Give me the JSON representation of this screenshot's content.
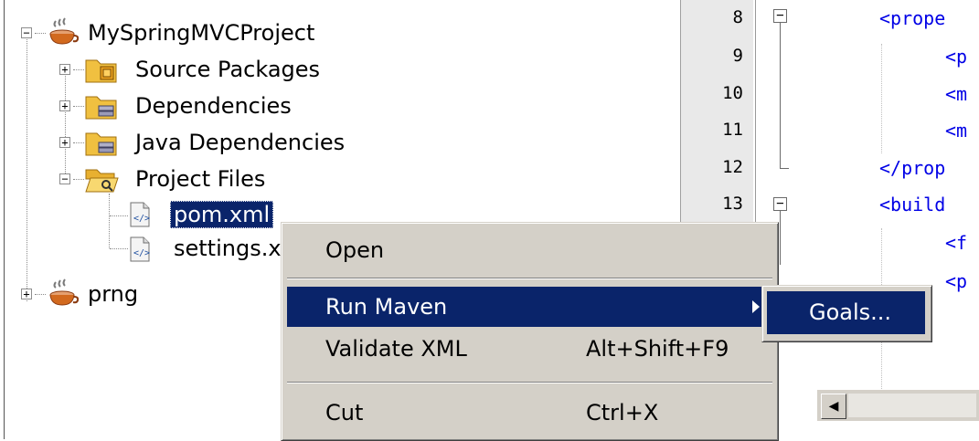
{
  "tree": {
    "items": [
      {
        "label": "MySpringMVCProject",
        "icon": "maven-project-icon",
        "expanded": true
      },
      {
        "label": "Source Packages",
        "icon": "source-packages-icon",
        "expanded": false
      },
      {
        "label": "Dependencies",
        "icon": "library-folder-icon",
        "expanded": false
      },
      {
        "label": "Java Dependencies",
        "icon": "library-folder-icon",
        "expanded": false
      },
      {
        "label": "Project Files",
        "icon": "open-folder-icon",
        "expanded": true
      },
      {
        "label": "pom.xml",
        "icon": "xml-file-icon",
        "selected": true
      },
      {
        "label": "settings.x",
        "icon": "xml-file-icon"
      },
      {
        "label": "prng",
        "icon": "maven-project-icon",
        "expanded": false
      }
    ]
  },
  "editor": {
    "line_numbers": [
      "8",
      "9",
      "10",
      "11",
      "12",
      "13"
    ],
    "code_lines": [
      "<prope",
      "<p",
      "<m",
      "<m",
      "</prop",
      "<build",
      "<f",
      "<p"
    ]
  },
  "context_menu": {
    "items": [
      {
        "label": "Open",
        "shortcut": ""
      },
      {
        "label": "Run Maven",
        "shortcut": "",
        "has_submenu": true,
        "highlighted": true
      },
      {
        "label": "Validate XML",
        "shortcut": "Alt+Shift+F9"
      },
      {
        "label": "Cut",
        "shortcut": "Ctrl+X"
      }
    ]
  },
  "submenu": {
    "items": [
      {
        "label": "Goals...",
        "highlighted": true
      }
    ]
  },
  "colors": {
    "selection": "#0a246a",
    "menu_bg": "#d4d0c8",
    "xml_tag": "#0000e6",
    "gutter_bg": "#e9e9e9"
  }
}
